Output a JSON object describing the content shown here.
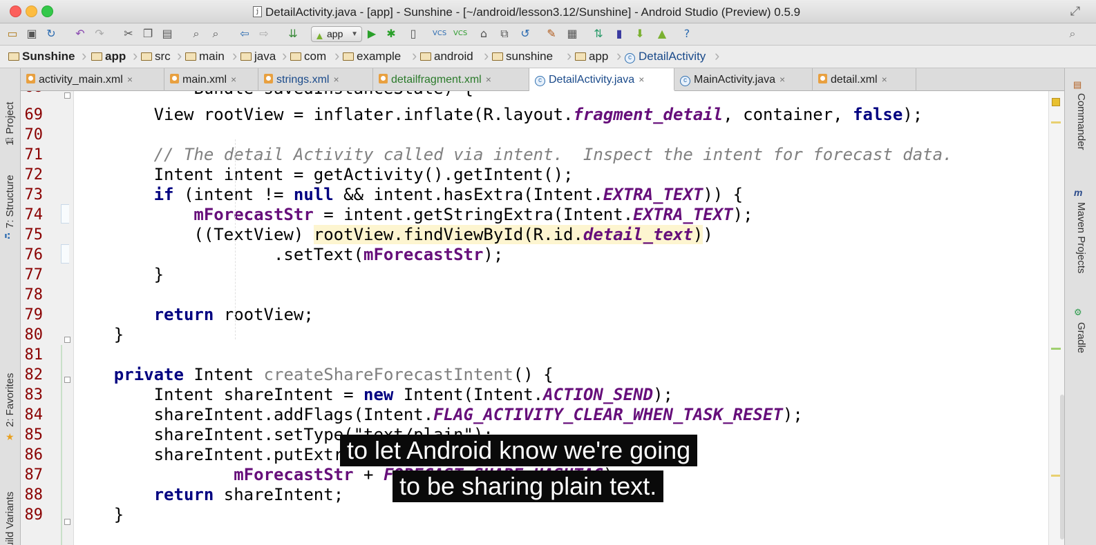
{
  "window": {
    "title": "DetailActivity.java - [app] - Sunshine - [~/android/lesson3.12/Sunshine] - Android Studio (Preview) 0.5.9"
  },
  "toolbar": {
    "run_config": "app"
  },
  "breadcrumbs": [
    {
      "label": "Sunshine",
      "bold": true
    },
    {
      "label": "app",
      "bold": true
    },
    {
      "label": "src"
    },
    {
      "label": "main"
    },
    {
      "label": "java"
    },
    {
      "label": "com"
    },
    {
      "label": "example"
    },
    {
      "label": "android"
    },
    {
      "label": "sunshine"
    },
    {
      "label": "app"
    },
    {
      "label": "DetailActivity"
    }
  ],
  "tabs": [
    {
      "label": "activity_main.xml",
      "icon": "xml-icon"
    },
    {
      "label": "main.xml",
      "icon": "xml-icon"
    },
    {
      "label": "strings.xml",
      "icon": "xml-icon"
    },
    {
      "label": "detailfragment.xml",
      "icon": "xml-icon"
    },
    {
      "label": "DetailActivity.java",
      "icon": "class-icon",
      "active": true
    },
    {
      "label": "MainActivity.java",
      "icon": "class-icon"
    },
    {
      "label": "detail.xml",
      "icon": "xml-icon"
    }
  ],
  "side_panels": {
    "left": [
      "1: Project",
      "7: Structure",
      "2: Favorites",
      "Build Variants"
    ],
    "right": [
      "Commander",
      "Maven Projects",
      "Gradle"
    ]
  },
  "code": {
    "first_partial_line": "68",
    "lines": [
      {
        "n": "69",
        "t": "        View rootView = inflater.inflate(R.layout.fragment_detail, container, false);"
      },
      {
        "n": "70",
        "t": ""
      },
      {
        "n": "71",
        "t": "        // The detail Activity called via intent.  Inspect the intent for forecast data."
      },
      {
        "n": "72",
        "t": "        Intent intent = getActivity().getIntent();"
      },
      {
        "n": "73",
        "t": "        if (intent != null && intent.hasExtra(Intent.EXTRA_TEXT)) {"
      },
      {
        "n": "74",
        "t": "            mForecastStr = intent.getStringExtra(Intent.EXTRA_TEXT);"
      },
      {
        "n": "75",
        "t": "            ((TextView) rootView.findViewById(R.id.detail_text))"
      },
      {
        "n": "76",
        "t": "                    .setText(mForecastStr);"
      },
      {
        "n": "77",
        "t": "        }"
      },
      {
        "n": "78",
        "t": ""
      },
      {
        "n": "79",
        "t": "        return rootView;"
      },
      {
        "n": "80",
        "t": "    }"
      },
      {
        "n": "81",
        "t": ""
      },
      {
        "n": "82",
        "t": "    private Intent createShareForecastIntent() {"
      },
      {
        "n": "83",
        "t": "        Intent shareIntent = new Intent(Intent.ACTION_SEND);"
      },
      {
        "n": "84",
        "t": "        shareIntent.addFlags(Intent.FLAG_ACTIVITY_CLEAR_WHEN_TASK_RESET);"
      },
      {
        "n": "85",
        "t": "        shareIntent.setType(\"text/plain\");"
      },
      {
        "n": "86",
        "t": "        shareIntent.putExtra(Intent.EXTRA_TEXT,"
      },
      {
        "n": "87",
        "t": "                mForecastStr + FORECAST_SHARE_HASHTAG);"
      },
      {
        "n": "88",
        "t": "        return shareIntent;"
      },
      {
        "n": "89",
        "t": "    }"
      }
    ]
  },
  "subtitles": [
    "to let Android know we're going",
    "to be sharing plain text."
  ],
  "colors": {
    "keyword": "#000080",
    "field": "#660e7a",
    "comment": "#808080",
    "line_number": "#8a0000",
    "highlight": "#fdf5d0"
  }
}
